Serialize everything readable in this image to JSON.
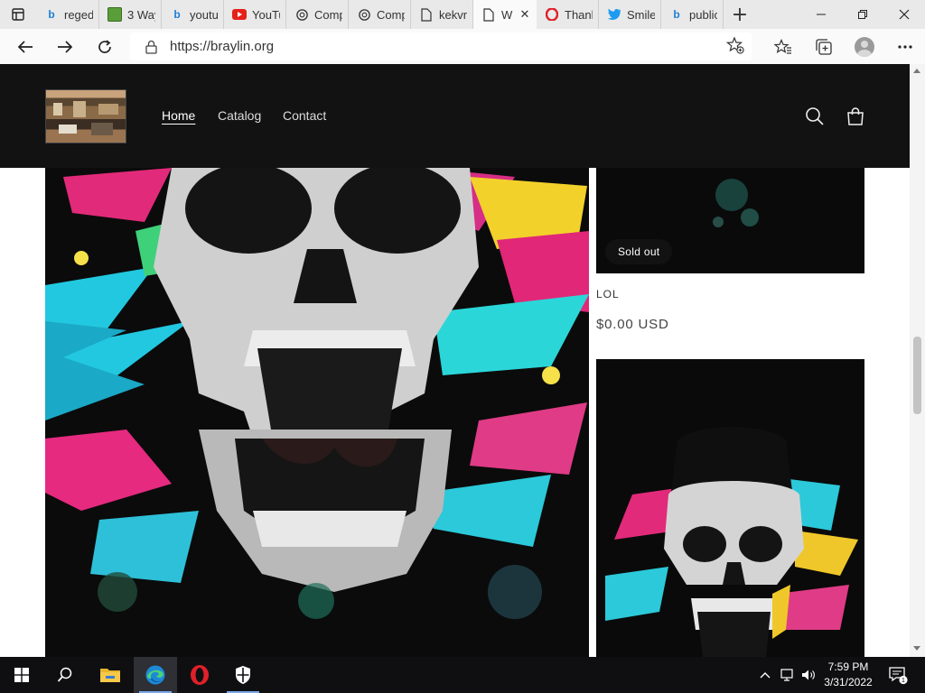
{
  "browser": {
    "tabs": [
      {
        "title": "reged",
        "icon": "bing-icon",
        "active": false
      },
      {
        "title": "3 Way",
        "icon": "minecraft-icon",
        "active": false
      },
      {
        "title": "youtu",
        "icon": "bing-icon",
        "active": false
      },
      {
        "title": "YouTu",
        "icon": "youtube-icon",
        "active": false
      },
      {
        "title": "Comp",
        "icon": "chatgpt-icon",
        "active": false
      },
      {
        "title": "Comp",
        "icon": "chatgpt-icon",
        "active": false
      },
      {
        "title": "kekvn",
        "icon": "page-icon",
        "active": false
      },
      {
        "title": "W",
        "icon": "page-icon",
        "active": true
      },
      {
        "title": "Thank",
        "icon": "opera-icon",
        "active": false
      },
      {
        "title": "Smile",
        "icon": "twitter-icon",
        "active": false
      },
      {
        "title": "public",
        "icon": "bing-icon",
        "active": false
      }
    ],
    "url": "https://braylin.org"
  },
  "site": {
    "nav": [
      {
        "label": "Home",
        "current": true
      },
      {
        "label": "Catalog",
        "current": false
      },
      {
        "label": "Contact",
        "current": false
      }
    ],
    "product": {
      "badge": "Sold out",
      "title": "LOL",
      "price": "$0.00 USD"
    }
  },
  "taskbar": {
    "time": "7:59 PM",
    "date": "3/31/2022",
    "notification_count": "1"
  },
  "colors": {
    "header_bg": "#121212",
    "tab_strip": "#e9e9e9",
    "taskbar": "#0f0f12"
  }
}
